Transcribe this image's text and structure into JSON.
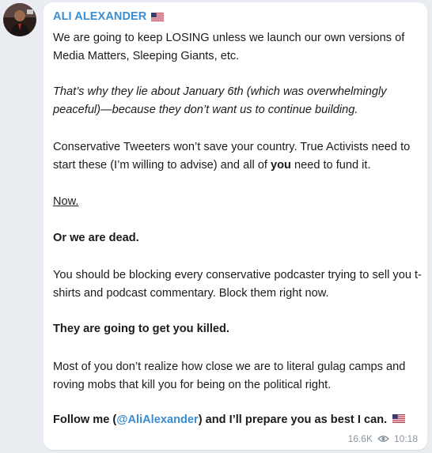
{
  "message": {
    "sender": "ALI ALEXANDER",
    "paragraphs": {
      "p1": "We are going to keep LOSING unless we launch our own versions of Media Matters, Sleeping Giants, etc.",
      "p2": "That’s why they lie about January 6th (which was overwhelmingly peaceful)—because they don’t want us to continue building.",
      "p3_before": "Conservative Tweeters won’t save your country. True Activists need to start these (I’m willing to advise) and all of ",
      "p3_bold": "you",
      "p3_after": " need to fund it.",
      "p4": "Now.",
      "p5": "Or we are dead.",
      "p6": "You should be blocking every conservative podcaster trying to sell you t-shirts and podcast commentary. Block them right now.",
      "p7": "They are going to get you killed.",
      "p8": "Most of you don’t realize how close we are to literal gulag camps and roving mobs that kill you for being on the political right.",
      "p9_before": "Follow me (",
      "p9_link": "@AliAlexander",
      "p9_after": ") and I’ll prepare you as best I can."
    },
    "views": "16.6K",
    "time": "10:18"
  },
  "icons": {
    "flag": "us-flag-icon",
    "views": "eye-icon"
  },
  "colors": {
    "accent": "#3a8dd0",
    "background": "#e9edf1",
    "bubble": "#ffffff",
    "meta": "#8a96a0"
  }
}
